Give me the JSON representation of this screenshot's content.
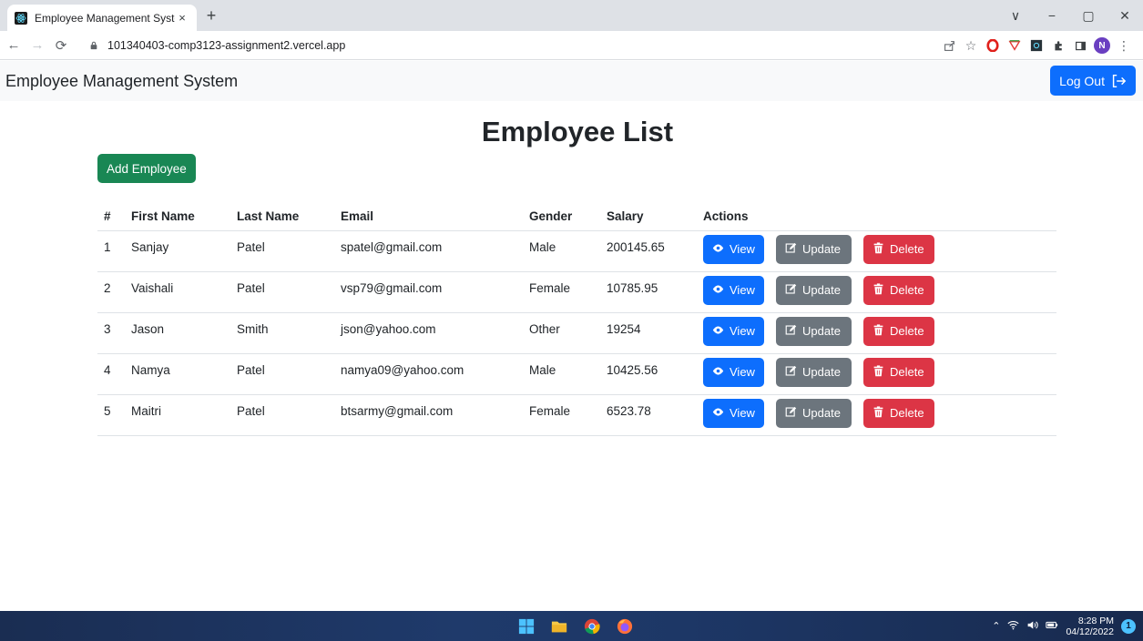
{
  "browser": {
    "tab_title": "Employee Management System",
    "tab_close": "×",
    "new_tab": "+",
    "url": "101340403-comp3123-assignment2.vercel.app",
    "profile_initial": "N",
    "window_controls": [
      "∨",
      "−",
      "▢",
      "✕"
    ]
  },
  "navbar": {
    "brand": "Employee Management System",
    "logout_label": "Log Out"
  },
  "main": {
    "title": "Employee List",
    "add_button": "Add Employee",
    "columns": [
      "#",
      "First Name",
      "Last Name",
      "Email",
      "Gender",
      "Salary",
      "Actions"
    ],
    "action_labels": {
      "view": "View",
      "update": "Update",
      "delete": "Delete"
    },
    "rows": [
      {
        "num": "1",
        "first": "Sanjay",
        "last": "Patel",
        "email": "spatel@gmail.com",
        "gender": "Male",
        "salary": "200145.65"
      },
      {
        "num": "2",
        "first": "Vaishali",
        "last": "Patel",
        "email": "vsp79@gmail.com",
        "gender": "Female",
        "salary": "10785.95"
      },
      {
        "num": "3",
        "first": "Jason",
        "last": "Smith",
        "email": "json@yahoo.com",
        "gender": "Other",
        "salary": "19254"
      },
      {
        "num": "4",
        "first": "Namya",
        "last": "Patel",
        "email": "namya09@yahoo.com",
        "gender": "Male",
        "salary": "10425.56"
      },
      {
        "num": "5",
        "first": "Maitri",
        "last": "Patel",
        "email": "btsarmy@gmail.com",
        "gender": "Female",
        "salary": "6523.78"
      }
    ]
  },
  "taskbar": {
    "time": "8:28 PM",
    "date": "04/12/2022",
    "notifications": "1"
  },
  "colors": {
    "primary": "#0d6efd",
    "success": "#198754",
    "secondary": "#6c757d",
    "danger": "#dc3545"
  }
}
